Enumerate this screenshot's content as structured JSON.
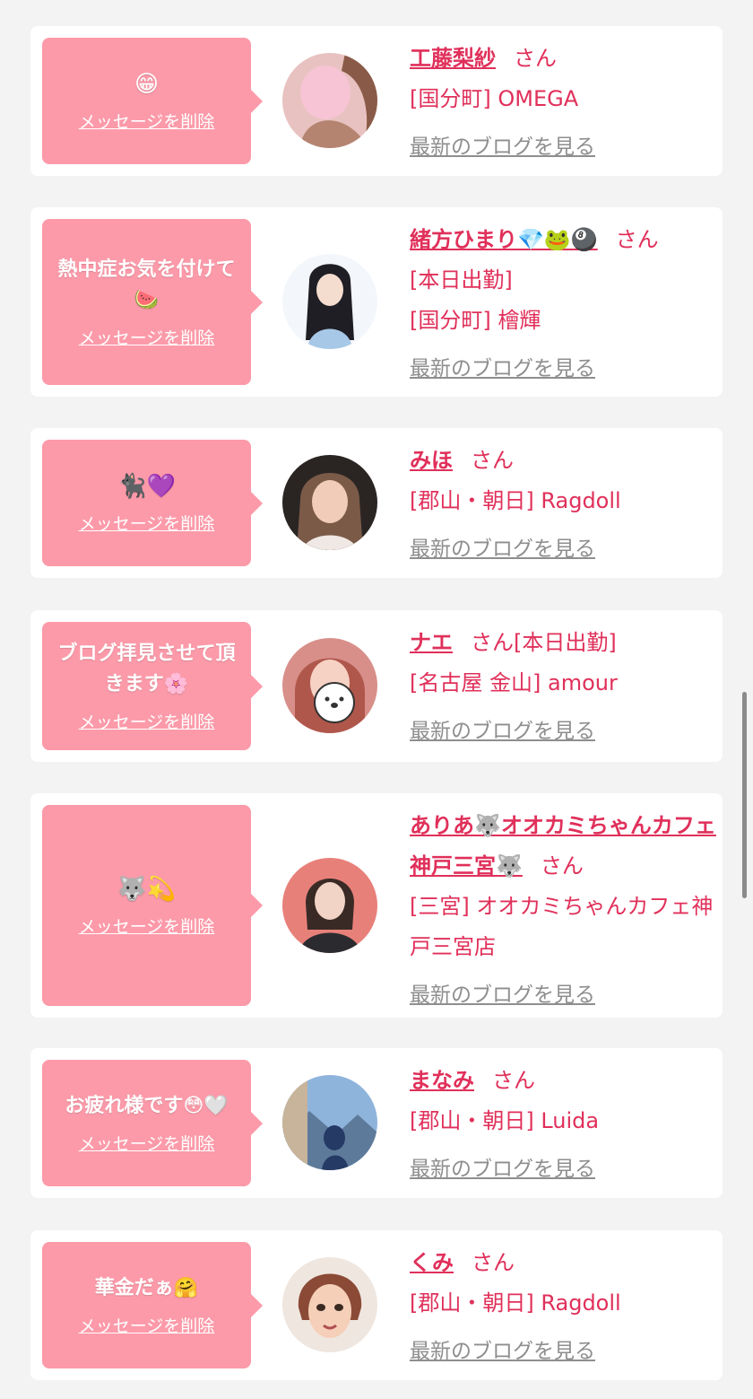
{
  "common": {
    "delete_label": "メッセージを削除",
    "blog_label": "最新のブログを見る",
    "san": "さん"
  },
  "colors": {
    "bubble": "#fc9aa9",
    "accent": "#e0305a",
    "link_gray": "#8e8e8e",
    "background": "#f3f3f3"
  },
  "cards": [
    {
      "message": "😁",
      "name": "工藤梨紗",
      "details": [
        "[国分町] OMEGA"
      ],
      "avatar_icon": "avatar-photo-icon"
    },
    {
      "message": "熱中症お気を付けて🍉",
      "name": "緒方ひまり💎🐸🎱",
      "details": [
        "[本日出勤]",
        "[国分町] 檜輝"
      ],
      "avatar_icon": "avatar-photo-icon"
    },
    {
      "message": "🐈‍⬛💜",
      "name": "みほ",
      "details": [
        "[郡山・朝日] Ragdoll"
      ],
      "avatar_icon": "avatar-photo-icon"
    },
    {
      "message": "ブログ拝見させて頂きます🌸",
      "name": "ナエ",
      "san_suffix": "[本日出勤]",
      "details": [
        "[名古屋 金山] amour"
      ],
      "avatar_icon": "avatar-photo-icon"
    },
    {
      "message": "🐺💫",
      "name": "ありあ🐺オオカミちゃんカフェ神戸三宮🐺",
      "details": [
        "[三宮] オオカミちゃんカフェ神戸三宮店"
      ],
      "avatar_icon": "avatar-photo-icon"
    },
    {
      "message": "お疲れ様です😳🤍",
      "name": "まなみ",
      "details": [
        "[郡山・朝日] Luida"
      ],
      "avatar_icon": "avatar-photo-icon"
    },
    {
      "message": "華金だぁ🤗",
      "name": "くみ",
      "details": [
        "[郡山・朝日] Ragdoll"
      ],
      "avatar_icon": "avatar-photo-icon"
    }
  ]
}
